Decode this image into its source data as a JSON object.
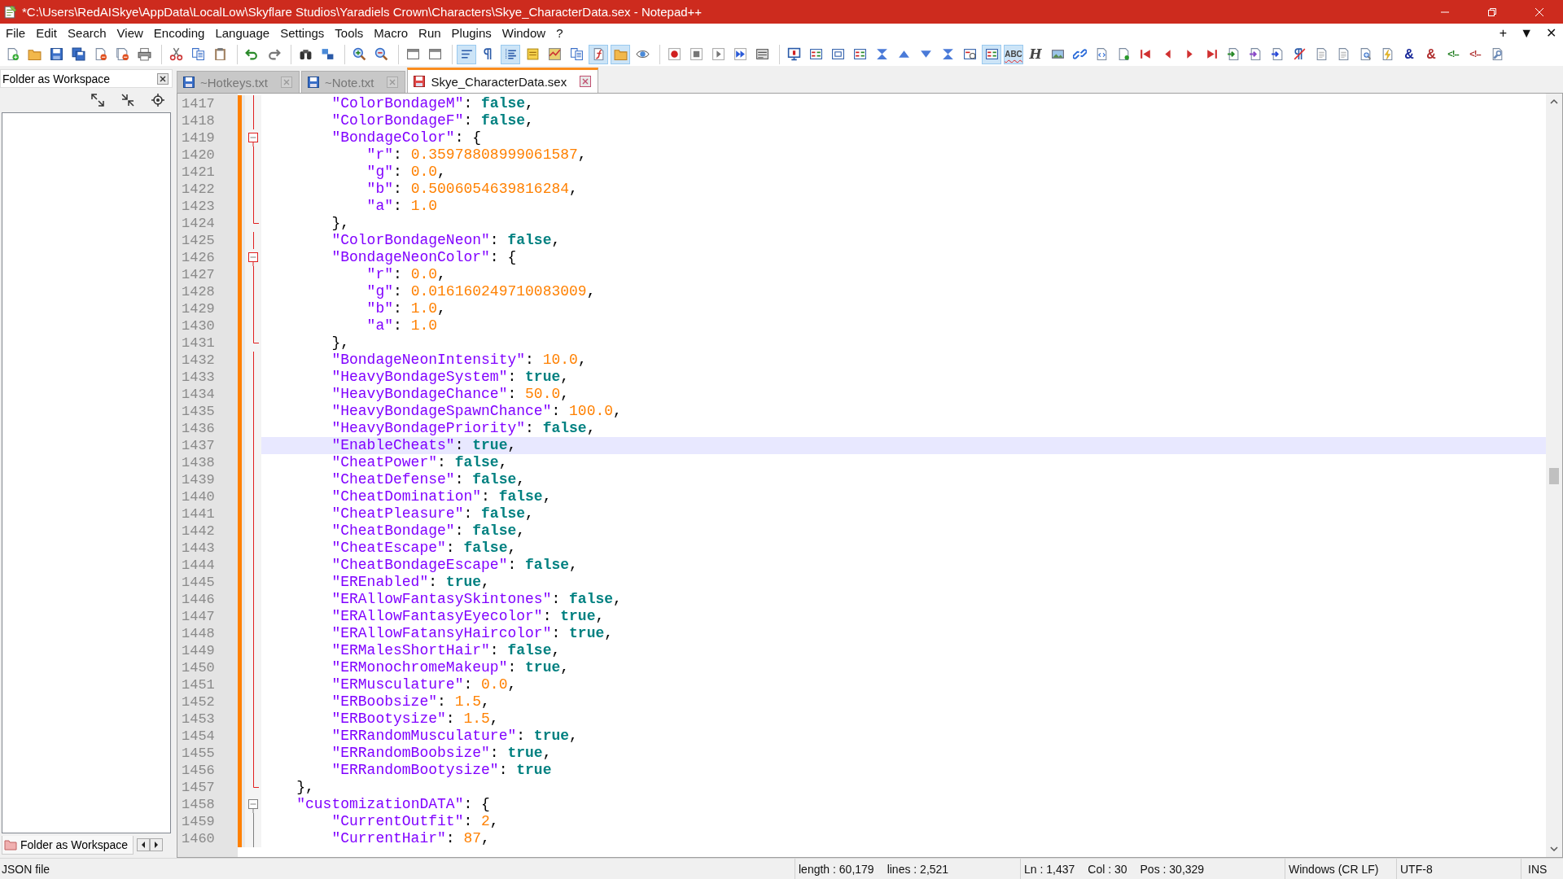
{
  "window": {
    "title": "*C:\\Users\\RedAISkye\\AppData\\LocalLow\\Skyflare Studios\\Yaradiels Crown\\Characters\\Skye_CharacterData.sex - Notepad++"
  },
  "menu": [
    "File",
    "Edit",
    "Search",
    "View",
    "Encoding",
    "Language",
    "Settings",
    "Tools",
    "Macro",
    "Run",
    "Plugins",
    "Window",
    "?"
  ],
  "tab_bar_controls": [
    "+",
    "▼",
    "✕"
  ],
  "toolbar": [
    [
      {
        "kind": "new-page",
        "pressed": false
      },
      {
        "kind": "folder",
        "pressed": false
      },
      {
        "kind": "disk",
        "pressed": false
      },
      {
        "kind": "disks",
        "pressed": false
      },
      {
        "kind": "close-page",
        "pressed": false
      },
      {
        "kind": "close-pages",
        "pressed": false
      },
      {
        "kind": "printer",
        "pressed": false
      }
    ],
    [
      {
        "kind": "scissors",
        "pressed": false
      },
      {
        "kind": "pages",
        "pressed": false
      },
      {
        "kind": "clipboard",
        "pressed": false
      }
    ],
    [
      {
        "kind": "undo",
        "pressed": false
      },
      {
        "kind": "redo",
        "pressed": false
      }
    ],
    [
      {
        "kind": "binoculars",
        "pressed": false
      },
      {
        "kind": "squares",
        "pressed": false
      }
    ],
    [
      {
        "kind": "zoom-in",
        "pressed": false
      },
      {
        "kind": "zoom-out",
        "pressed": false
      }
    ],
    [
      {
        "kind": "window",
        "pressed": false
      },
      {
        "kind": "window",
        "pressed": false
      }
    ],
    [
      {
        "kind": "lines",
        "pressed": true
      },
      {
        "kind": "pilcrow",
        "pressed": false
      },
      {
        "kind": "indent-lines",
        "pressed": true
      },
      {
        "kind": "notepad",
        "pressed": false
      },
      {
        "kind": "map",
        "pressed": false
      },
      {
        "kind": "pages",
        "pressed": false
      },
      {
        "kind": "function-page",
        "pressed": true
      },
      {
        "kind": "folder",
        "pressed": true
      },
      {
        "kind": "eye",
        "pressed": false
      }
    ],
    [
      {
        "kind": "record",
        "pressed": false
      },
      {
        "kind": "stop",
        "pressed": false
      },
      {
        "kind": "play",
        "pressed": false
      },
      {
        "kind": "fast-forward",
        "pressed": false
      },
      {
        "kind": "list-window",
        "pressed": false
      }
    ],
    [
      {
        "kind": "monitor",
        "pressed": false
      },
      {
        "kind": "bars-window",
        "pressed": false
      },
      {
        "kind": "frame-window",
        "pressed": false
      },
      {
        "kind": "bars-window",
        "pressed": false
      },
      {
        "kind": "hourglass",
        "pressed": false
      },
      {
        "kind": "triangle-up",
        "pressed": false
      },
      {
        "kind": "triangle-down",
        "pressed": false
      },
      {
        "kind": "hourglass",
        "pressed": false
      },
      {
        "kind": "clock-window",
        "pressed": false
      },
      {
        "kind": "bars-window",
        "pressed": true
      },
      {
        "kind": "spell-check",
        "glyph": "ABC",
        "pressed": true
      },
      {
        "kind": "letter",
        "glyph": "H",
        "pressed": false
      },
      {
        "kind": "image",
        "pressed": false
      },
      {
        "kind": "chain-link",
        "pressed": false
      },
      {
        "kind": "code-page",
        "pressed": false
      },
      {
        "kind": "dot-page",
        "pressed": false
      },
      {
        "kind": "skip-first",
        "pressed": false
      },
      {
        "kind": "triangle-left",
        "pressed": false
      },
      {
        "kind": "triangle-right",
        "pressed": false
      },
      {
        "kind": "skip-last",
        "pressed": false
      },
      {
        "kind": "arrow-page-green",
        "pressed": false
      },
      {
        "kind": "arrow-page-purple",
        "pressed": false
      },
      {
        "kind": "arrow-page-blue",
        "pressed": false
      },
      {
        "kind": "pilcrow-crossed",
        "pressed": false
      },
      {
        "kind": "text-page",
        "pressed": false
      },
      {
        "kind": "text-page",
        "pressed": false
      },
      {
        "kind": "search-page",
        "pressed": false
      },
      {
        "kind": "lightning-page",
        "pressed": false
      },
      {
        "kind": "ampersand",
        "glyph": "&",
        "pressed": false
      },
      {
        "kind": "ampersand-crossed",
        "glyph": "&",
        "pressed": false
      },
      {
        "kind": "comment-tag",
        "glyph": "<!--",
        "pressed": false
      },
      {
        "kind": "comment-tag-crossed",
        "glyph": "<!--",
        "pressed": false
      },
      {
        "kind": "wrench-page",
        "pressed": false
      }
    ]
  ],
  "sidebar": {
    "title": "Folder as Workspace",
    "bottom_tab": "Folder as Workspace"
  },
  "tabs": [
    {
      "label": "~Hotkeys.txt",
      "selected": false,
      "modified": false
    },
    {
      "label": "~Note.txt",
      "selected": false,
      "modified": false
    },
    {
      "label": "Skye_CharacterData.sex",
      "selected": true,
      "modified": true
    }
  ],
  "code": [
    {
      "highlighted": true,
      "children": [
        {
          "number": "1417",
          "key": "\"ColorBondageM\"",
          "colon": ":",
          "value": "false",
          "kind": "bool",
          "comma": ",",
          "changed": true,
          "selected": false
        },
        {
          "number": "1418",
          "key": "\"ColorBondageF\"",
          "colon": ":",
          "value": "false",
          "kind": "bool",
          "comma": ",",
          "changed": true,
          "selected": false
        },
        {
          "number": "1419",
          "key": "\"BondageColor\"",
          "colon": ":",
          "brace": "{",
          "changed": true,
          "selected": false,
          "children": [
            {
              "number": "1420",
              "key": "\"r\"",
              "colon": ":",
              "value": "0.35978808999061587",
              "kind": "number",
              "comma": ",",
              "changed": true,
              "selected": false
            },
            {
              "number": "1421",
              "key": "\"g\"",
              "colon": ":",
              "value": "0.0",
              "kind": "number",
              "comma": ",",
              "changed": true,
              "selected": false
            },
            {
              "number": "1422",
              "key": "\"b\"",
              "colon": ":",
              "value": "0.5006054639816284",
              "kind": "number",
              "comma": ",",
              "changed": true,
              "selected": false
            },
            {
              "number": "1423",
              "key": "\"a\"",
              "colon": ":",
              "value": "1.0",
              "kind": "number",
              "changed": true,
              "selected": false
            }
          ],
          "close": {
            "number": "1424",
            "text": "},",
            "changed": true,
            "selected": false
          }
        },
        {
          "number": "1425",
          "key": "\"ColorBondageNeon\"",
          "colon": ":",
          "value": "false",
          "kind": "bool",
          "comma": ",",
          "changed": true,
          "selected": false
        },
        {
          "number": "1426",
          "key": "\"BondageNeonColor\"",
          "colon": ":",
          "brace": "{",
          "changed": true,
          "selected": false,
          "children": [
            {
              "number": "1427",
              "key": "\"r\"",
              "colon": ":",
              "value": "0.0",
              "kind": "number",
              "comma": ",",
              "changed": true,
              "selected": false
            },
            {
              "number": "1428",
              "key": "\"g\"",
              "colon": ":",
              "value": "0.016160249710083009",
              "kind": "number",
              "comma": ",",
              "changed": true,
              "selected": false
            },
            {
              "number": "1429",
              "key": "\"b\"",
              "colon": ":",
              "value": "1.0",
              "kind": "number",
              "comma": ",",
              "changed": true,
              "selected": false
            },
            {
              "number": "1430",
              "key": "\"a\"",
              "colon": ":",
              "value": "1.0",
              "kind": "number",
              "changed": true,
              "selected": false
            }
          ],
          "close": {
            "number": "1431",
            "text": "},",
            "changed": true,
            "selected": false
          }
        },
        {
          "number": "1432",
          "key": "\"BondageNeonIntensity\"",
          "colon": ":",
          "value": "10.0",
          "kind": "number",
          "comma": ",",
          "changed": true,
          "selected": false
        },
        {
          "number": "1433",
          "key": "\"HeavyBondageSystem\"",
          "colon": ":",
          "value": "true",
          "kind": "bool",
          "comma": ",",
          "changed": true,
          "selected": false
        },
        {
          "number": "1434",
          "key": "\"HeavyBondageChance\"",
          "colon": ":",
          "value": "50.0",
          "kind": "number",
          "comma": ",",
          "changed": true,
          "selected": false
        },
        {
          "number": "1435",
          "key": "\"HeavyBondageSpawnChance\"",
          "colon": ":",
          "value": "100.0",
          "kind": "number",
          "comma": ",",
          "changed": true,
          "selected": false
        },
        {
          "number": "1436",
          "key": "\"HeavyBondagePriority\"",
          "colon": ":",
          "value": "false",
          "kind": "bool",
          "comma": ",",
          "changed": true,
          "selected": false
        },
        {
          "number": "1437",
          "key": "\"EnableCheats\"",
          "colon": ":",
          "value": "true",
          "kind": "bool",
          "comma": ",",
          "changed": true,
          "selected": true
        },
        {
          "number": "1438",
          "key": "\"CheatPower\"",
          "colon": ":",
          "value": "false",
          "kind": "bool",
          "comma": ",",
          "changed": true,
          "selected": false
        },
        {
          "number": "1439",
          "key": "\"CheatDefense\"",
          "colon": ":",
          "value": "false",
          "kind": "bool",
          "comma": ",",
          "changed": true,
          "selected": false
        },
        {
          "number": "1440",
          "key": "\"CheatDomination\"",
          "colon": ":",
          "value": "false",
          "kind": "bool",
          "comma": ",",
          "changed": true,
          "selected": false
        },
        {
          "number": "1441",
          "key": "\"CheatPleasure\"",
          "colon": ":",
          "value": "false",
          "kind": "bool",
          "comma": ",",
          "changed": true,
          "selected": false
        },
        {
          "number": "1442",
          "key": "\"CheatBondage\"",
          "colon": ":",
          "value": "false",
          "kind": "bool",
          "comma": ",",
          "changed": true,
          "selected": false
        },
        {
          "number": "1443",
          "key": "\"CheatEscape\"",
          "colon": ":",
          "value": "false",
          "kind": "bool",
          "comma": ",",
          "changed": true,
          "selected": false
        },
        {
          "number": "1444",
          "key": "\"CheatBondageEscape\"",
          "colon": ":",
          "value": "false",
          "kind": "bool",
          "comma": ",",
          "changed": true,
          "selected": false
        },
        {
          "number": "1445",
          "key": "\"EREnabled\"",
          "colon": ":",
          "value": "true",
          "kind": "bool",
          "comma": ",",
          "changed": true,
          "selected": false
        },
        {
          "number": "1446",
          "key": "\"ERAllowFantasySkintones\"",
          "colon": ":",
          "value": "false",
          "kind": "bool",
          "comma": ",",
          "changed": true,
          "selected": false
        },
        {
          "number": "1447",
          "key": "\"ERAllowFantasyEyecolor\"",
          "colon": ":",
          "value": "true",
          "kind": "bool",
          "comma": ",",
          "changed": true,
          "selected": false
        },
        {
          "number": "1448",
          "key": "\"ERAllowFatansyHaircolor\"",
          "colon": ":",
          "value": "true",
          "kind": "bool",
          "comma": ",",
          "changed": true,
          "selected": false
        },
        {
          "number": "1449",
          "key": "\"ERMalesShortHair\"",
          "colon": ":",
          "value": "false",
          "kind": "bool",
          "comma": ",",
          "changed": true,
          "selected": false
        },
        {
          "number": "1450",
          "key": "\"ERMonochromeMakeup\"",
          "colon": ":",
          "value": "true",
          "kind": "bool",
          "comma": ",",
          "changed": true,
          "selected": false
        },
        {
          "number": "1451",
          "key": "\"ERMusculature\"",
          "colon": ":",
          "value": "0.0",
          "kind": "number",
          "comma": ",",
          "changed": true,
          "selected": false
        },
        {
          "number": "1452",
          "key": "\"ERBoobsize\"",
          "colon": ":",
          "value": "1.5",
          "kind": "number",
          "comma": ",",
          "changed": true,
          "selected": false
        },
        {
          "number": "1453",
          "key": "\"ERBootysize\"",
          "colon": ":",
          "value": "1.5",
          "kind": "number",
          "comma": ",",
          "changed": true,
          "selected": false
        },
        {
          "number": "1454",
          "key": "\"ERRandomMusculature\"",
          "colon": ":",
          "value": "true",
          "kind": "bool",
          "comma": ",",
          "changed": true,
          "selected": false
        },
        {
          "number": "1455",
          "key": "\"ERRandomBoobsize\"",
          "colon": ":",
          "value": "true",
          "kind": "bool",
          "comma": ",",
          "changed": true,
          "selected": false
        },
        {
          "number": "1456",
          "key": "\"ERRandomBootysize\"",
          "colon": ":",
          "value": "true",
          "kind": "bool",
          "changed": true,
          "selected": false
        }
      ],
      "close": {
        "number": "1457",
        "text": "},",
        "changed": true,
        "selected": false
      }
    },
    {
      "highlighted": false,
      "number": "1458",
      "key": "\"customizationDATA\"",
      "colon": ":",
      "brace": "{",
      "changed": true,
      "selected": false,
      "children": [
        {
          "number": "1459",
          "key": "\"CurrentOutfit\"",
          "colon": ":",
          "value": "2",
          "kind": "number",
          "comma": ",",
          "changed": true,
          "selected": false
        },
        {
          "number": "1460",
          "key": "\"CurrentHair\"",
          "colon": ":",
          "value": "87",
          "kind": "number",
          "comma": ",",
          "changed": true,
          "selected": false
        }
      ]
    }
  ],
  "status_bar": {
    "file_type": "JSON file",
    "length": "length : 60,179",
    "lines": "lines : 2,521",
    "ln": "Ln : 1,437",
    "col": "Col : 30",
    "pos": "Pos : 30,329",
    "eol": "Windows (CR LF)",
    "encoding": "UTF-8",
    "mode": "INS"
  }
}
